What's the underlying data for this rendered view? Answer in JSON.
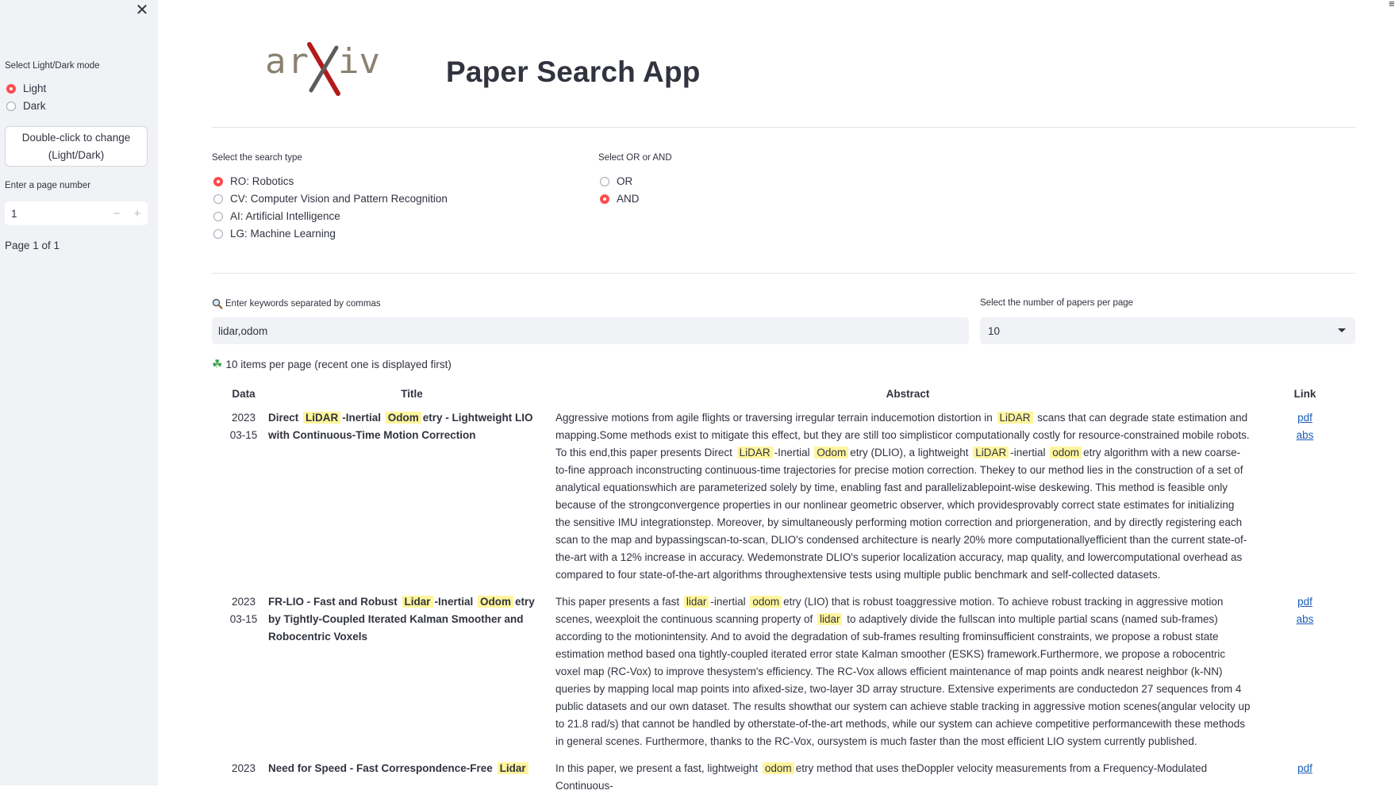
{
  "sidebar": {
    "close_symbol": "✕",
    "mode_label": "Select Light/Dark mode",
    "mode_options": [
      "Light",
      "Dark"
    ],
    "mode_selected": "Light",
    "mode_button": "Double-click to change (Light/Dark)",
    "page_label": "Enter a page number",
    "page_value": "1",
    "stepper_minus": "−",
    "stepper_plus": "+",
    "page_status": "Page 1 of 1"
  },
  "header": {
    "logo_text": "arXiv",
    "title": "Paper Search App"
  },
  "search_type": {
    "label": "Select the search type",
    "options": [
      "RO: Robotics",
      "CV: Computer Vision and Pattern Recognition",
      "AI: Artificial Intelligence",
      "LG: Machine Learning"
    ],
    "selected": "RO: Robotics"
  },
  "logic": {
    "label": "Select OR or AND",
    "options": [
      "OR",
      "AND"
    ],
    "selected": "AND"
  },
  "keywords": {
    "label": "Enter keywords separated by commas",
    "value": "lidar,odom"
  },
  "per_page": {
    "label": "Select the number of papers per page",
    "value": "10"
  },
  "info": "10 items per page (recent one is displayed first)",
  "table": {
    "headers": [
      "Data",
      "Title",
      "Abstract",
      "Link"
    ],
    "rows": [
      {
        "year": "2023",
        "date": "03-15",
        "title": [
          "Direct ",
          {
            "hl": "LiDAR"
          },
          "-Inertial ",
          {
            "hl": "Odom"
          },
          "etry - Lightweight LIO with Continuous-Time Motion Correction"
        ],
        "abstract": [
          "Aggressive motions from agile flights or traversing irregular terrain inducemotion distortion in ",
          {
            "hl": "LiDAR"
          },
          " scans that can degrade state estimation and mapping.Some methods exist to mitigate this effect, but they are still too simplisticor computationally costly for resource-constrained mobile robots. To this end,this paper presents Direct ",
          {
            "hl": "LiDAR"
          },
          "-Inertial ",
          {
            "hl": "Odom"
          },
          "etry (DLIO), a lightweight ",
          {
            "hl": "LiDAR"
          },
          "-inertial ",
          {
            "hl": "odom"
          },
          "etry algorithm with a new coarse-to-fine approach inconstructing continuous-time trajectories for precise motion correction. Thekey to our method lies in the construction of a set of analytical equationswhich are parameterized solely by time, enabling fast and parallelizablepoint-wise deskewing. This method is feasible only because of the strongconvergence properties in our nonlinear geometric observer, which providesprovably correct state estimates for initializing the sensitive IMU integrationstep. Moreover, by simultaneously performing motion correction and priorgeneration, and by directly registering each scan to the map and bypassingscan-to-scan, DLIO's condensed architecture is nearly 20% more computationallyefficient than the current state-of-the-art with a 12% increase in accuracy. Wedemonstrate DLIO's superior localization accuracy, map quality, and lowercomputational overhead as compared to four state-of-the-art algorithms throughextensive tests using multiple public benchmark and self-collected datasets."
        ],
        "links": [
          "pdf",
          "abs"
        ]
      },
      {
        "year": "2023",
        "date": "03-15",
        "title": [
          "FR-LIO - Fast and Robust ",
          {
            "hl": "Lidar"
          },
          "-Inertial ",
          {
            "hl": "Odom"
          },
          "etry by Tightly-Coupled Iterated Kalman Smoother and Robocentric Voxels"
        ],
        "abstract": [
          "This paper presents a fast ",
          {
            "hl": "lidar"
          },
          "-inertial ",
          {
            "hl": "odom"
          },
          "etry (LIO) that is robust toaggressive motion. To achieve robust tracking in aggressive motion scenes, weexploit the continuous scanning property of ",
          {
            "hl": "lidar"
          },
          " to adaptively divide the fullscan into multiple partial scans (named sub-frames) according to the motionintensity. And to avoid the degradation of sub-frames resulting frominsufficient constraints, we propose a robust state estimation method based ona tightly-coupled iterated error state Kalman smoother (ESKS) framework.Furthermore, we propose a robocentric voxel map (RC-Vox) to improve thesystem's efficiency. The RC-Vox allows efficient maintenance of map points andk nearest neighbor (k-NN) queries by mapping local map points into afixed-size, two-layer 3D array structure. Extensive experiments are conductedon 27 sequences from 4 public datasets and our own dataset. The results showthat our system can achieve stable tracking in aggressive motion scenes(angular velocity up to 21.8 rad/s) that cannot be handled by otherstate-of-the-art methods, while our system can achieve competitive performancewith these methods in general scenes. Furthermore, thanks to the RC-Vox, oursystem is much faster than the most efficient LIO system currently published."
        ],
        "links": [
          "pdf",
          "abs"
        ]
      },
      {
        "year": "2023",
        "date": "",
        "title": [
          "Need for Speed - Fast Correspondence-Free ",
          {
            "hl": "Lidar"
          }
        ],
        "abstract": [
          "In this paper, we present a fast, lightweight ",
          {
            "hl": "odom"
          },
          "etry method that uses theDoppler velocity measurements from a Frequency-Modulated Continuous-"
        ],
        "links": [
          "pdf"
        ]
      }
    ]
  },
  "colors": {
    "accent": "#ff4b4b",
    "sidebar_bg": "#f0f2f6",
    "highlight": "#fff59d",
    "link": "#1a5fb4"
  }
}
